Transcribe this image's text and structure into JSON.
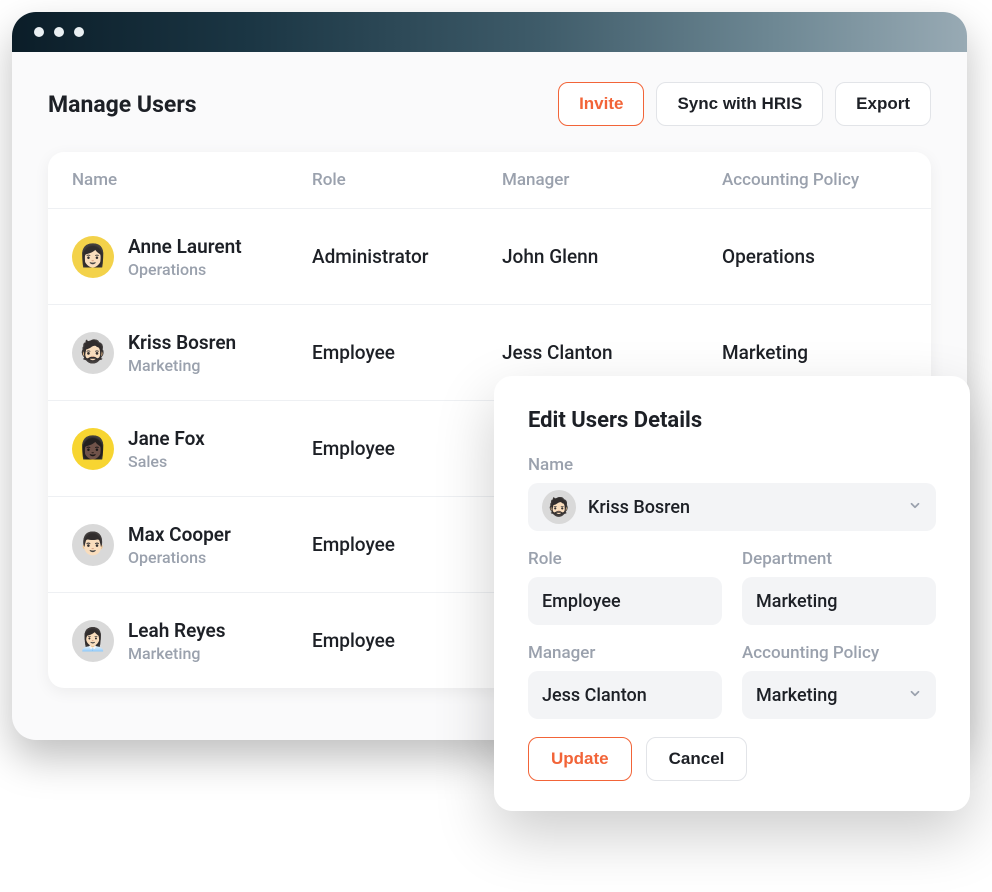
{
  "header": {
    "title": "Manage Users",
    "actions": {
      "invite": "Invite",
      "sync": "Sync with HRIS",
      "export": "Export"
    }
  },
  "table": {
    "columns": {
      "name": "Name",
      "role": "Role",
      "manager": "Manager",
      "policy": "Accounting Policy"
    },
    "rows": [
      {
        "name": "Anne Laurent",
        "dept": "Operations",
        "role": "Administrator",
        "manager": "John Glenn",
        "policy": "Operations",
        "avatar_bg": "#f3d24a",
        "avatar_emoji": "👩🏻"
      },
      {
        "name": "Kriss Bosren",
        "dept": "Marketing",
        "role": "Employee",
        "manager": "Jess Clanton",
        "policy": "Marketing",
        "avatar_bg": "#d9d9d9",
        "avatar_emoji": "🧔🏻"
      },
      {
        "name": "Jane Fox",
        "dept": "Sales",
        "role": "Employee",
        "manager": "",
        "policy": "",
        "avatar_bg": "#f7d531",
        "avatar_emoji": "👩🏿"
      },
      {
        "name": "Max Cooper",
        "dept": "Operations",
        "role": "Employee",
        "manager": "",
        "policy": "",
        "avatar_bg": "#d9d9d9",
        "avatar_emoji": "👨🏻"
      },
      {
        "name": "Leah Reyes",
        "dept": "Marketing",
        "role": "Employee",
        "manager": "",
        "policy": "",
        "avatar_bg": "#d9d9d9",
        "avatar_emoji": "👩🏻‍💼"
      }
    ]
  },
  "panel": {
    "title": "Edit Users Details",
    "labels": {
      "name": "Name",
      "role": "Role",
      "department": "Department",
      "manager": "Manager",
      "policy": "Accounting Policy"
    },
    "values": {
      "name": "Kriss Bosren",
      "role": "Employee",
      "department": "Marketing",
      "manager": "Jess Clanton",
      "policy": "Marketing"
    },
    "avatar_bg": "#d9d9d9",
    "avatar_emoji": "🧔🏻",
    "actions": {
      "update": "Update",
      "cancel": "Cancel"
    }
  }
}
